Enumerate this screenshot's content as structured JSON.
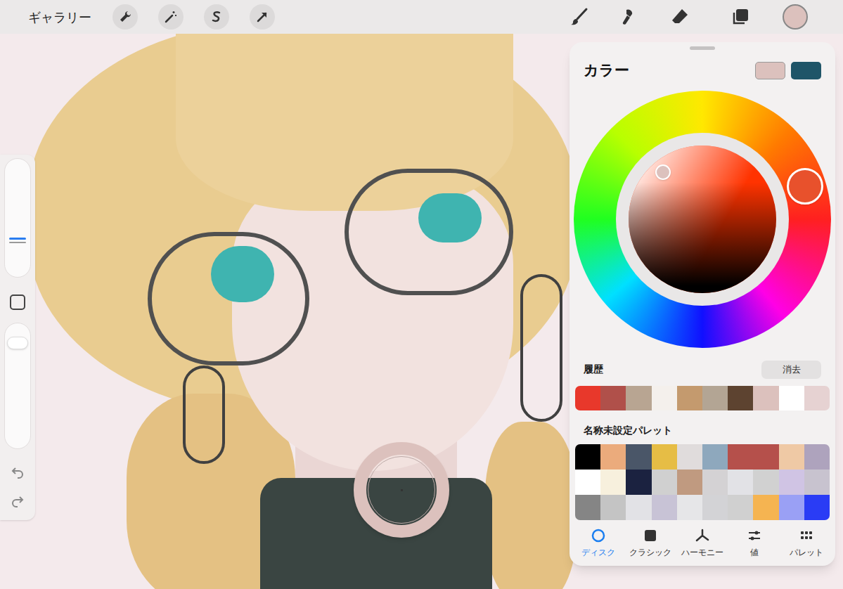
{
  "toolbar": {
    "gallery": "ギャラリー"
  },
  "sidebar": {
    "size_level": 0.32,
    "opacity_level": 0.88
  },
  "color_panel": {
    "title": "カラー",
    "primary": "#dcc1bd",
    "secondary": "#1f5568",
    "hue": 12,
    "saturation": 0.12,
    "brightness": 0.9,
    "history": {
      "label": "履歴",
      "clear": "消去",
      "swatches": [
        {
          "color": "#e8382b"
        },
        {
          "color": "#b0504a"
        },
        {
          "color": "#b8a592"
        },
        {
          "color": "#f4f0ec"
        },
        {
          "color": "#c49a6e"
        },
        {
          "color": "#b3a594"
        },
        {
          "color": "#5d4330"
        },
        {
          "color": "#dcc1bd"
        },
        {
          "color": "#ffffff"
        },
        {
          "color": "#e6d2d2"
        }
      ]
    },
    "palette": {
      "name": "名称未設定パレット",
      "swatches": [
        {
          "color": "#000000"
        },
        {
          "color": "#ebab7c"
        },
        {
          "color": "#4a5668"
        },
        {
          "color": "#e6bd45"
        },
        {
          "color": "#e0dcdc"
        },
        {
          "color": "#8ea8bd"
        },
        {
          "color": "#b5504b"
        },
        {
          "color": "#b5504b"
        },
        {
          "color": "#efc9a5"
        },
        {
          "color": "#aea3bd"
        },
        {
          "color": "#ffffff"
        },
        {
          "color": "#f7f0dd"
        },
        {
          "color": "#1b2240"
        },
        {
          "color": "#d0d0d0"
        },
        {
          "color": "#c09a80"
        },
        {
          "color": "#d4d2d4"
        },
        {
          "color": "#e2e2e6"
        },
        {
          "color": "#d1d1d1"
        },
        {
          "color": "#d0c4e4"
        },
        {
          "color": "#c8c3cf"
        },
        {
          "color": "#858585"
        },
        {
          "color": "#c4c4c4"
        },
        {
          "color": "#e2e2e6"
        },
        {
          "color": "#c8c3d6"
        },
        {
          "color": "#e6e6e8"
        },
        {
          "color": "#d3d3d6"
        },
        {
          "color": "#d0d0d0"
        },
        {
          "color": "#f5b451"
        },
        {
          "color": "#9aa0f5"
        },
        {
          "color": "#2a3cf5"
        }
      ]
    },
    "tabs": [
      {
        "label": "ディスク",
        "selected": true
      },
      {
        "label": "クラシック",
        "selected": false
      },
      {
        "label": "ハーモニー",
        "selected": false
      },
      {
        "label": "値",
        "selected": false
      },
      {
        "label": "パレット",
        "selected": false
      }
    ]
  }
}
